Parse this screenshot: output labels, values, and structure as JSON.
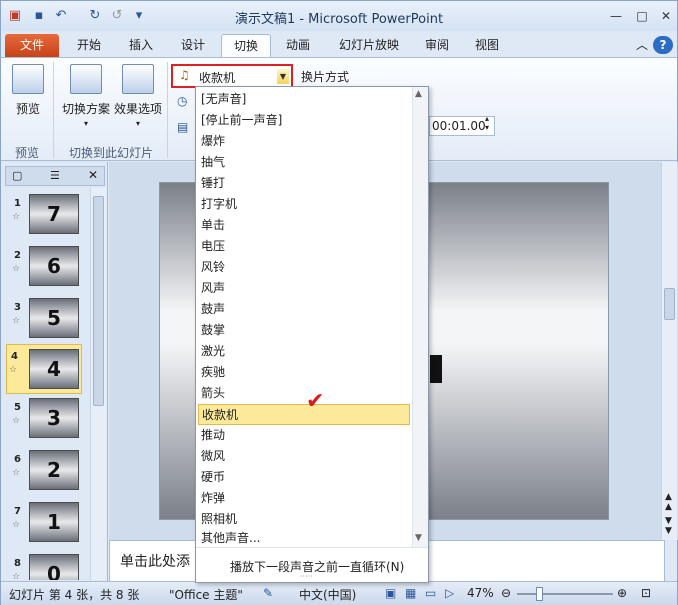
{
  "window": {
    "title": "演示文稿1 - Microsoft PowerPoint"
  },
  "tabs": [
    {
      "label": "文件"
    },
    {
      "label": "开始"
    },
    {
      "label": "插入"
    },
    {
      "label": "设计"
    },
    {
      "label": "切换"
    },
    {
      "label": "动画"
    },
    {
      "label": "幻灯片放映"
    },
    {
      "label": "审阅"
    },
    {
      "label": "视图"
    }
  ],
  "ribbon": {
    "preview_label": "预览",
    "transition_scheme_label": "切换方案",
    "effect_options_label": "效果选项",
    "group_preview": "预览",
    "group_transition": "切换到此幻灯片",
    "sound_value": "收款机",
    "switch_mode_label": "换片方式",
    "duration_value": "00:01.00"
  },
  "slides": [
    {
      "num": "1",
      "text": "7"
    },
    {
      "num": "2",
      "text": "6"
    },
    {
      "num": "3",
      "text": "5"
    },
    {
      "num": "4",
      "text": "4"
    },
    {
      "num": "5",
      "text": "3"
    },
    {
      "num": "6",
      "text": "2"
    },
    {
      "num": "7",
      "text": "1"
    },
    {
      "num": "8",
      "text": "0"
    }
  ],
  "notes_placeholder": "单击此处添",
  "status": {
    "slide_info": "幻灯片 第 4 张，共 8 张",
    "theme": "\"Office 主题\"",
    "language": "中文(中国)",
    "zoom": "47%"
  },
  "sound_menu": {
    "items": [
      "[无声音]",
      "[停止前一声音]",
      "爆炸",
      "抽气",
      "锤打",
      "打字机",
      "单击",
      "电压",
      "风铃",
      "风声",
      "鼓声",
      "鼓掌",
      "激光",
      "疾驰",
      "箭头",
      "收款机",
      "推动",
      "微风",
      "硬币",
      "炸弹",
      "照相机",
      "其他声音..."
    ],
    "loop_label": "播放下一段声音之前一直循环(N)"
  }
}
